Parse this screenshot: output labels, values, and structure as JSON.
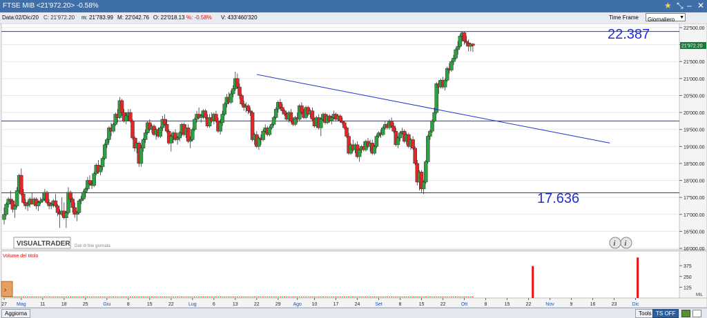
{
  "window": {
    "title": "FTSE MIB <21'972.20> -0.58%",
    "star_icon": "star-icon",
    "pin_icon": "pin-icon"
  },
  "info": {
    "date": "Data:02/Dic/20",
    "close": "C: 21'972.20",
    "min": "m: 21'783.99",
    "max": "M: 22'042.76",
    "open": "O: 22'018.13",
    "pct": "%: -0.58%",
    "volume": "V: 433'460'320",
    "timeframe_label": "Time Frame",
    "timeframe_value": "Giornaliero"
  },
  "overlay": {
    "watermark": "VISUALTRADER",
    "watermark_sub": "Dati di fine giornata",
    "high_label": "22.387",
    "low_label": "17.636",
    "price_tag": "21'972.20",
    "volume_panel_title": "Volume del titolo",
    "volume_indicator": "MIL"
  },
  "statusbar": {
    "update_label": "Aggiorna",
    "tools_label": "Tools",
    "tsoff_label": "TS OFF"
  },
  "colors": {
    "up": "#2ea043",
    "down": "#e02828",
    "trend": "#2233cc",
    "label": "#1f2ed6",
    "volume": "#ee1111",
    "price_tag_bg": "#1a7a3a"
  },
  "chart_data": {
    "type": "candlestick",
    "ylim": [
      16000,
      22500
    ],
    "ylabel_ticks": [
      "22'500.00",
      "22'000.00",
      "21'500.00",
      "21'000.00",
      "20'500.00",
      "20'000.00",
      "19'500.00",
      "19'000.00",
      "18'500.00",
      "18'000.00",
      "17'500.00",
      "17'000.00",
      "16'500.00",
      "16'000.00"
    ],
    "ytick_values": [
      22500,
      22000,
      21500,
      21000,
      20500,
      20000,
      19500,
      19000,
      18500,
      18000,
      17500,
      17000,
      16500,
      16000
    ],
    "xtick_labels": [
      "27",
      "Mag",
      "11",
      "18",
      "25",
      "Giu",
      "8",
      "15",
      "22",
      "Lug",
      "6",
      "13",
      "22",
      "29",
      "Ago",
      "10",
      "17",
      "24",
      "Set",
      "8",
      "15",
      "22",
      "Ott",
      "8",
      "15",
      "22",
      "Nov",
      "9",
      "16",
      "23",
      "Dic"
    ],
    "month_labels": [
      "Mag",
      "Giu",
      "Lug",
      "Ago",
      "Set",
      "Ott",
      "Nov",
      "Dic"
    ],
    "xtick_index": [
      0,
      8,
      18,
      28,
      38,
      48,
      58,
      68,
      78,
      88,
      98,
      108,
      118,
      128,
      137,
      145,
      155,
      165,
      175,
      185,
      195,
      205,
      215,
      225,
      235,
      245,
      255,
      265,
      275,
      285,
      295
    ],
    "horizontal_lines": [
      22387,
      19750,
      17636
    ],
    "trendline": {
      "from": [
        118,
        21120
      ],
      "to": [
        283,
        19100
      ]
    },
    "volume_ticks": [
      "375",
      "250",
      "125"
    ],
    "volume_tick_values": [
      375,
      250,
      125
    ],
    "volume_ylim": [
      0,
      480
    ],
    "volume_spikes": [
      {
        "i": 247,
        "v": 370
      },
      {
        "i": 296,
        "v": 470
      }
    ],
    "baseline_volume": 8,
    "candles": [
      [
        16850,
        17200,
        16700,
        17000
      ],
      [
        17000,
        17350,
        16950,
        17300
      ],
      [
        17300,
        17500,
        17200,
        17450
      ],
      [
        17450,
        17700,
        17300,
        17400
      ],
      [
        17400,
        17450,
        17050,
        17150
      ],
      [
        17150,
        17300,
        16900,
        17250
      ],
      [
        17250,
        17800,
        17200,
        17700
      ],
      [
        17700,
        18200,
        17650,
        18150
      ],
      [
        18150,
        18350,
        17550,
        17600
      ],
      [
        17600,
        17750,
        17300,
        17350
      ],
      [
        17350,
        17450,
        17150,
        17250
      ],
      [
        17250,
        17400,
        17100,
        17300
      ],
      [
        17300,
        17500,
        17200,
        17450
      ],
      [
        17450,
        17650,
        17300,
        17300
      ],
      [
        17300,
        17500,
        17250,
        17450
      ],
      [
        17450,
        17500,
        17150,
        17250
      ],
      [
        17250,
        17400,
        17100,
        17350
      ],
      [
        17350,
        17500,
        17300,
        17400
      ],
      [
        17400,
        17650,
        17350,
        17450
      ],
      [
        17450,
        17750,
        17400,
        17650
      ],
      [
        17650,
        17700,
        17300,
        17350
      ],
      [
        17350,
        17450,
        17150,
        17250
      ],
      [
        17250,
        17350,
        17150,
        17300
      ],
      [
        17300,
        17450,
        17200,
        17400
      ],
      [
        17400,
        17600,
        17200,
        17250
      ],
      [
        17250,
        17300,
        16950,
        17050
      ],
      [
        17050,
        17150,
        16600,
        17000
      ],
      [
        17000,
        17500,
        16950,
        17100
      ],
      [
        17100,
        17350,
        16850,
        16900
      ],
      [
        16900,
        17100,
        16600,
        17050
      ],
      [
        17050,
        17800,
        17000,
        17650
      ],
      [
        17650,
        17700,
        17350,
        17450
      ],
      [
        17450,
        17500,
        17050,
        17200
      ],
      [
        17200,
        17350,
        16900,
        17000
      ],
      [
        17000,
        17100,
        16800,
        17050
      ],
      [
        17050,
        17450,
        17000,
        17400
      ],
      [
        17400,
        17550,
        17300,
        17450
      ],
      [
        17450,
        17700,
        17400,
        17650
      ],
      [
        17650,
        17800,
        17500,
        17750
      ],
      [
        17750,
        18100,
        17700,
        18000
      ],
      [
        18000,
        18150,
        17850,
        17900
      ],
      [
        17900,
        18000,
        17750,
        17850
      ],
      [
        17850,
        18250,
        17800,
        18200
      ],
      [
        18200,
        18500,
        18150,
        18450
      ],
      [
        18450,
        18600,
        18200,
        18250
      ],
      [
        18250,
        18450,
        18150,
        18400
      ],
      [
        18400,
        18700,
        18300,
        18650
      ],
      [
        18650,
        19100,
        18600,
        19050
      ],
      [
        19050,
        19250,
        18950,
        19200
      ],
      [
        19200,
        19600,
        19100,
        19550
      ],
      [
        19550,
        19700,
        19300,
        19450
      ],
      [
        19450,
        19700,
        19400,
        19650
      ],
      [
        19650,
        20000,
        19600,
        19950
      ],
      [
        19950,
        20100,
        19700,
        19850
      ],
      [
        19850,
        20450,
        19800,
        20350
      ],
      [
        20350,
        20400,
        19900,
        20000
      ],
      [
        20000,
        20100,
        19700,
        19750
      ],
      [
        19750,
        20000,
        19650,
        19900
      ],
      [
        19900,
        20100,
        19750,
        20000
      ],
      [
        20000,
        20100,
        19700,
        19750
      ],
      [
        19750,
        19800,
        19200,
        19250
      ],
      [
        19250,
        19300,
        18850,
        18950
      ],
      [
        18950,
        19250,
        18800,
        19100
      ],
      [
        19100,
        19150,
        18400,
        18500
      ],
      [
        18500,
        19050,
        18400,
        18950
      ],
      [
        18950,
        19250,
        18850,
        19200
      ],
      [
        19200,
        19500,
        19100,
        19400
      ],
      [
        19400,
        19750,
        19350,
        19700
      ],
      [
        19700,
        19800,
        19450,
        19500
      ],
      [
        19500,
        19650,
        19400,
        19600
      ],
      [
        19600,
        19650,
        19300,
        19350
      ],
      [
        19350,
        19550,
        19200,
        19500
      ],
      [
        19500,
        19550,
        19250,
        19300
      ],
      [
        19300,
        19600,
        19250,
        19550
      ],
      [
        19550,
        19900,
        19450,
        19800
      ],
      [
        19800,
        19950,
        19600,
        19650
      ],
      [
        19650,
        19800,
        19400,
        19450
      ],
      [
        19450,
        19500,
        19050,
        19100
      ],
      [
        19100,
        19350,
        18850,
        19300
      ],
      [
        19300,
        19450,
        19100,
        19400
      ],
      [
        19400,
        19500,
        19150,
        19200
      ],
      [
        19200,
        19300,
        19050,
        19250
      ],
      [
        19250,
        19450,
        19150,
        19400
      ],
      [
        19400,
        19700,
        19300,
        19650
      ],
      [
        19650,
        19700,
        19300,
        19350
      ],
      [
        19350,
        19650,
        19250,
        19550
      ],
      [
        19550,
        19650,
        19100,
        19150
      ],
      [
        19150,
        19300,
        18950,
        19200
      ],
      [
        19200,
        19550,
        19150,
        19500
      ],
      [
        19500,
        19850,
        19450,
        19800
      ],
      [
        19800,
        20050,
        19700,
        19950
      ],
      [
        19950,
        20150,
        19800,
        19850
      ],
      [
        19850,
        19950,
        19700,
        19900
      ],
      [
        19900,
        20100,
        19800,
        20050
      ],
      [
        20050,
        20100,
        19800,
        19850
      ],
      [
        19850,
        19950,
        19550,
        19600
      ],
      [
        19600,
        19950,
        19550,
        19850
      ],
      [
        19850,
        20000,
        19700,
        19750
      ],
      [
        19750,
        20000,
        19650,
        19950
      ],
      [
        19950,
        20050,
        19700,
        19750
      ],
      [
        19750,
        19850,
        19400,
        19450
      ],
      [
        19450,
        19800,
        19350,
        19700
      ],
      [
        19700,
        20050,
        19600,
        19950
      ],
      [
        19950,
        20300,
        19900,
        20250
      ],
      [
        20250,
        20550,
        20150,
        20450
      ],
      [
        20450,
        20600,
        20250,
        20300
      ],
      [
        20300,
        20650,
        20250,
        20550
      ],
      [
        20550,
        20800,
        20450,
        20700
      ],
      [
        20700,
        21200,
        20650,
        21000
      ],
      [
        21000,
        21150,
        20700,
        20750
      ],
      [
        20750,
        20850,
        20400,
        20500
      ],
      [
        20500,
        20550,
        20200,
        20250
      ],
      [
        20250,
        20350,
        20050,
        20150
      ],
      [
        20150,
        20300,
        20000,
        20200
      ],
      [
        20200,
        20250,
        19950,
        20050
      ],
      [
        20050,
        20150,
        19900,
        20000
      ],
      [
        20000,
        20050,
        19150,
        19200
      ],
      [
        19200,
        19400,
        19050,
        19350
      ],
      [
        19350,
        19450,
        18950,
        19000
      ],
      [
        19000,
        19300,
        18900,
        19250
      ],
      [
        19250,
        19350,
        19050,
        19200
      ],
      [
        19200,
        19500,
        19150,
        19450
      ],
      [
        19450,
        19650,
        19400,
        19550
      ],
      [
        19550,
        19600,
        19300,
        19350
      ],
      [
        19350,
        19600,
        19300,
        19550
      ],
      [
        19550,
        19700,
        19500,
        19650
      ],
      [
        19650,
        19900,
        19600,
        19850
      ],
      [
        19850,
        20150,
        19800,
        20100
      ],
      [
        20100,
        20350,
        20000,
        20300
      ],
      [
        20300,
        20400,
        20100,
        20150
      ],
      [
        20150,
        20250,
        19950,
        20050
      ],
      [
        20050,
        20100,
        19900,
        19950
      ],
      [
        19950,
        20000,
        19750,
        19800
      ],
      [
        19800,
        20050,
        19700,
        20000
      ],
      [
        20000,
        20100,
        19700,
        19750
      ],
      [
        19750,
        19850,
        19600,
        19650
      ],
      [
        19650,
        19900,
        19600,
        19850
      ],
      [
        19850,
        20000,
        19700,
        19800
      ],
      [
        19800,
        20250,
        19750,
        20200
      ],
      [
        20200,
        20300,
        19950,
        20000
      ],
      [
        20000,
        20100,
        19800,
        19850
      ],
      [
        19850,
        20200,
        19800,
        20150
      ],
      [
        20150,
        20200,
        19900,
        19950
      ],
      [
        19950,
        20100,
        19850,
        20050
      ],
      [
        20050,
        20150,
        19750,
        19800
      ],
      [
        19800,
        19850,
        19550,
        19600
      ],
      [
        19600,
        19900,
        19550,
        19850
      ],
      [
        19850,
        19950,
        19500,
        19550
      ],
      [
        19550,
        19850,
        19300,
        19800
      ],
      [
        19800,
        20000,
        19750,
        19950
      ],
      [
        19950,
        20000,
        19650,
        19700
      ],
      [
        19700,
        19950,
        19650,
        19900
      ],
      [
        19900,
        19950,
        19700,
        19750
      ],
      [
        19750,
        19900,
        19650,
        19850
      ],
      [
        19850,
        20050,
        19800,
        19950
      ],
      [
        19950,
        20000,
        19750,
        19800
      ],
      [
        19800,
        19950,
        19750,
        19900
      ],
      [
        19900,
        19950,
        19700,
        19750
      ],
      [
        19750,
        19850,
        19650,
        19700
      ],
      [
        19700,
        19750,
        19500,
        19550
      ],
      [
        19550,
        19600,
        19250,
        19300
      ],
      [
        19300,
        19400,
        18750,
        18800
      ],
      [
        18800,
        19100,
        18750,
        19050
      ],
      [
        19050,
        19200,
        18850,
        18900
      ],
      [
        18900,
        19100,
        18800,
        19050
      ],
      [
        19050,
        19150,
        18650,
        18700
      ],
      [
        18700,
        18950,
        18550,
        18900
      ],
      [
        18900,
        19050,
        18800,
        19000
      ],
      [
        19000,
        19150,
        18850,
        18900
      ],
      [
        18900,
        19200,
        18850,
        19150
      ],
      [
        19150,
        19250,
        18950,
        19000
      ],
      [
        19000,
        19200,
        18850,
        19100
      ],
      [
        19100,
        19200,
        18750,
        18800
      ],
      [
        18800,
        19050,
        18750,
        19000
      ],
      [
        19000,
        19350,
        18950,
        19300
      ],
      [
        19300,
        19450,
        19250,
        19400
      ],
      [
        19400,
        19500,
        19250,
        19350
      ],
      [
        19350,
        19600,
        19300,
        19550
      ],
      [
        19550,
        19750,
        19500,
        19650
      ],
      [
        19650,
        19700,
        19500,
        19550
      ],
      [
        19550,
        19800,
        19500,
        19750
      ],
      [
        19750,
        19850,
        19550,
        19600
      ],
      [
        19600,
        19700,
        19400,
        19450
      ],
      [
        19450,
        19550,
        19000,
        19050
      ],
      [
        19050,
        19300,
        18950,
        19250
      ],
      [
        19250,
        19450,
        19150,
        19400
      ],
      [
        19400,
        19550,
        19350,
        19450
      ],
      [
        19450,
        19500,
        19100,
        19150
      ],
      [
        19150,
        19400,
        19050,
        19350
      ],
      [
        19350,
        19400,
        18950,
        19000
      ],
      [
        19000,
        19250,
        18900,
        19200
      ],
      [
        19200,
        19300,
        18900,
        18950
      ],
      [
        18950,
        19000,
        18450,
        18500
      ],
      [
        18500,
        18600,
        17850,
        17950
      ],
      [
        17950,
        18300,
        17700,
        18250
      ],
      [
        18250,
        18300,
        17650,
        17750
      ],
      [
        17750,
        18000,
        17600,
        17950
      ],
      [
        17950,
        18600,
        17900,
        18550
      ],
      [
        18550,
        19350,
        18500,
        19300
      ],
      [
        19300,
        19500,
        19200,
        19450
      ],
      [
        19450,
        19800,
        19400,
        19750
      ],
      [
        19750,
        20150,
        19700,
        20000
      ],
      [
        20000,
        20900,
        19950,
        20850
      ],
      [
        20850,
        20950,
        20550,
        20750
      ],
      [
        20750,
        21000,
        20700,
        20950
      ],
      [
        20950,
        21050,
        20700,
        20750
      ],
      [
        20750,
        21000,
        20650,
        20950
      ],
      [
        20950,
        21350,
        20900,
        21300
      ],
      [
        21300,
        21450,
        21150,
        21250
      ],
      [
        21250,
        21550,
        21200,
        21500
      ],
      [
        21500,
        21700,
        21400,
        21600
      ],
      [
        21600,
        21900,
        21550,
        21850
      ],
      [
        21850,
        22100,
        21700,
        21950
      ],
      [
        21950,
        22300,
        21900,
        22250
      ],
      [
        22250,
        22387,
        22100,
        22350
      ],
      [
        22350,
        22380,
        22000,
        22100
      ],
      [
        22100,
        22250,
        21950,
        22050
      ],
      [
        22050,
        22150,
        21800,
        21950
      ],
      [
        21950,
        22050,
        21800,
        22018
      ],
      [
        22018,
        22043,
        21784,
        21972
      ]
    ]
  }
}
